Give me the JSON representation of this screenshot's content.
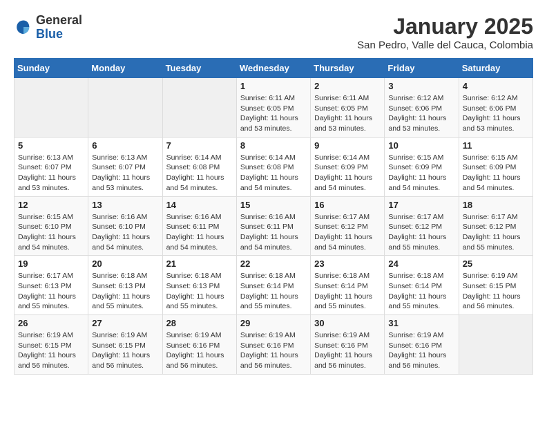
{
  "header": {
    "logo_general": "General",
    "logo_blue": "Blue",
    "title": "January 2025",
    "subtitle": "San Pedro, Valle del Cauca, Colombia"
  },
  "days_of_week": [
    "Sunday",
    "Monday",
    "Tuesday",
    "Wednesday",
    "Thursday",
    "Friday",
    "Saturday"
  ],
  "weeks": [
    [
      {
        "day": "",
        "info": ""
      },
      {
        "day": "",
        "info": ""
      },
      {
        "day": "",
        "info": ""
      },
      {
        "day": "1",
        "info": "Sunrise: 6:11 AM\nSunset: 6:05 PM\nDaylight: 11 hours and 53 minutes."
      },
      {
        "day": "2",
        "info": "Sunrise: 6:11 AM\nSunset: 6:05 PM\nDaylight: 11 hours and 53 minutes."
      },
      {
        "day": "3",
        "info": "Sunrise: 6:12 AM\nSunset: 6:06 PM\nDaylight: 11 hours and 53 minutes."
      },
      {
        "day": "4",
        "info": "Sunrise: 6:12 AM\nSunset: 6:06 PM\nDaylight: 11 hours and 53 minutes."
      }
    ],
    [
      {
        "day": "5",
        "info": "Sunrise: 6:13 AM\nSunset: 6:07 PM\nDaylight: 11 hours and 53 minutes."
      },
      {
        "day": "6",
        "info": "Sunrise: 6:13 AM\nSunset: 6:07 PM\nDaylight: 11 hours and 53 minutes."
      },
      {
        "day": "7",
        "info": "Sunrise: 6:14 AM\nSunset: 6:08 PM\nDaylight: 11 hours and 54 minutes."
      },
      {
        "day": "8",
        "info": "Sunrise: 6:14 AM\nSunset: 6:08 PM\nDaylight: 11 hours and 54 minutes."
      },
      {
        "day": "9",
        "info": "Sunrise: 6:14 AM\nSunset: 6:09 PM\nDaylight: 11 hours and 54 minutes."
      },
      {
        "day": "10",
        "info": "Sunrise: 6:15 AM\nSunset: 6:09 PM\nDaylight: 11 hours and 54 minutes."
      },
      {
        "day": "11",
        "info": "Sunrise: 6:15 AM\nSunset: 6:09 PM\nDaylight: 11 hours and 54 minutes."
      }
    ],
    [
      {
        "day": "12",
        "info": "Sunrise: 6:15 AM\nSunset: 6:10 PM\nDaylight: 11 hours and 54 minutes."
      },
      {
        "day": "13",
        "info": "Sunrise: 6:16 AM\nSunset: 6:10 PM\nDaylight: 11 hours and 54 minutes."
      },
      {
        "day": "14",
        "info": "Sunrise: 6:16 AM\nSunset: 6:11 PM\nDaylight: 11 hours and 54 minutes."
      },
      {
        "day": "15",
        "info": "Sunrise: 6:16 AM\nSunset: 6:11 PM\nDaylight: 11 hours and 54 minutes."
      },
      {
        "day": "16",
        "info": "Sunrise: 6:17 AM\nSunset: 6:12 PM\nDaylight: 11 hours and 54 minutes."
      },
      {
        "day": "17",
        "info": "Sunrise: 6:17 AM\nSunset: 6:12 PM\nDaylight: 11 hours and 55 minutes."
      },
      {
        "day": "18",
        "info": "Sunrise: 6:17 AM\nSunset: 6:12 PM\nDaylight: 11 hours and 55 minutes."
      }
    ],
    [
      {
        "day": "19",
        "info": "Sunrise: 6:17 AM\nSunset: 6:13 PM\nDaylight: 11 hours and 55 minutes."
      },
      {
        "day": "20",
        "info": "Sunrise: 6:18 AM\nSunset: 6:13 PM\nDaylight: 11 hours and 55 minutes."
      },
      {
        "day": "21",
        "info": "Sunrise: 6:18 AM\nSunset: 6:13 PM\nDaylight: 11 hours and 55 minutes."
      },
      {
        "day": "22",
        "info": "Sunrise: 6:18 AM\nSunset: 6:14 PM\nDaylight: 11 hours and 55 minutes."
      },
      {
        "day": "23",
        "info": "Sunrise: 6:18 AM\nSunset: 6:14 PM\nDaylight: 11 hours and 55 minutes."
      },
      {
        "day": "24",
        "info": "Sunrise: 6:18 AM\nSunset: 6:14 PM\nDaylight: 11 hours and 55 minutes."
      },
      {
        "day": "25",
        "info": "Sunrise: 6:19 AM\nSunset: 6:15 PM\nDaylight: 11 hours and 56 minutes."
      }
    ],
    [
      {
        "day": "26",
        "info": "Sunrise: 6:19 AM\nSunset: 6:15 PM\nDaylight: 11 hours and 56 minutes."
      },
      {
        "day": "27",
        "info": "Sunrise: 6:19 AM\nSunset: 6:15 PM\nDaylight: 11 hours and 56 minutes."
      },
      {
        "day": "28",
        "info": "Sunrise: 6:19 AM\nSunset: 6:16 PM\nDaylight: 11 hours and 56 minutes."
      },
      {
        "day": "29",
        "info": "Sunrise: 6:19 AM\nSunset: 6:16 PM\nDaylight: 11 hours and 56 minutes."
      },
      {
        "day": "30",
        "info": "Sunrise: 6:19 AM\nSunset: 6:16 PM\nDaylight: 11 hours and 56 minutes."
      },
      {
        "day": "31",
        "info": "Sunrise: 6:19 AM\nSunset: 6:16 PM\nDaylight: 11 hours and 56 minutes."
      },
      {
        "day": "",
        "info": ""
      }
    ]
  ]
}
